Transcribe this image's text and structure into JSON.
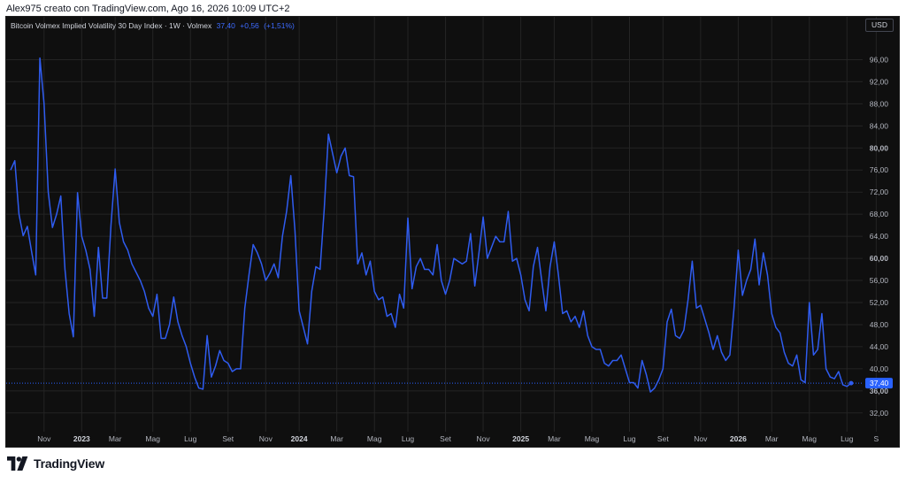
{
  "header": {
    "caption": "Alex975 creato con TradingView.com, Ago 16, 2026 10:09 UTC+2"
  },
  "legend": {
    "title": "Bitcoin Volmex Implied Volatility 30 Day Index · 1W · Volmex",
    "last": "37,40",
    "change": "+0,56",
    "change_pct": "(+1,51%)"
  },
  "currency_label": "USD",
  "brand": {
    "name": "TradingView",
    "logo_icon": "tradingview-logo-icon"
  },
  "colors": {
    "background": "#0f0f0f",
    "line": "#2f5cf0",
    "grid": "#242424",
    "axis_text": "#b2b5be",
    "price_tag": "#2962ff"
  },
  "chart_data": {
    "type": "line",
    "title": "Bitcoin Volmex Implied Volatility 30 Day Index · 1W · Volmex",
    "xlabel": "",
    "ylabel": "",
    "ylim": [
      28.6,
      100.4
    ],
    "grid": true,
    "last_value_label": "37,40",
    "y_ticks": [
      32,
      36,
      40,
      44,
      48,
      52,
      56,
      60,
      64,
      68,
      72,
      76,
      80,
      84,
      88,
      92,
      96
    ],
    "y_tick_labels": [
      "32,00",
      "36,00",
      "40,00",
      "44,00",
      "48,00",
      "52,00",
      "56,00",
      "60,00",
      "64,00",
      "68,00",
      "72,00",
      "76,00",
      "80,00",
      "84,00",
      "88,00",
      "92,00",
      "96,00"
    ],
    "y_tick_bold": [
      false,
      true,
      false,
      false,
      false,
      false,
      false,
      true,
      false,
      false,
      false,
      false,
      true,
      false,
      false,
      false,
      false
    ],
    "x_ticks": [
      {
        "label": "Nov",
        "week": 8,
        "bold": false
      },
      {
        "label": "2023",
        "week": 17,
        "bold": true
      },
      {
        "label": "Mar",
        "week": 25,
        "bold": false
      },
      {
        "label": "Mag",
        "week": 34,
        "bold": false
      },
      {
        "label": "Lug",
        "week": 43,
        "bold": false
      },
      {
        "label": "Set",
        "week": 52,
        "bold": false
      },
      {
        "label": "Nov",
        "week": 61,
        "bold": false
      },
      {
        "label": "2024",
        "week": 69,
        "bold": true
      },
      {
        "label": "Mar",
        "week": 78,
        "bold": false
      },
      {
        "label": "Mag",
        "week": 87,
        "bold": false
      },
      {
        "label": "Lug",
        "week": 95,
        "bold": false
      },
      {
        "label": "Set",
        "week": 104,
        "bold": false
      },
      {
        "label": "Nov",
        "week": 113,
        "bold": false
      },
      {
        "label": "2025",
        "week": 122,
        "bold": true
      },
      {
        "label": "Mar",
        "week": 130,
        "bold": false
      },
      {
        "label": "Mag",
        "week": 139,
        "bold": false
      },
      {
        "label": "Lug",
        "week": 148,
        "bold": false
      },
      {
        "label": "Set",
        "week": 156,
        "bold": false
      },
      {
        "label": "Nov",
        "week": 165,
        "bold": false
      },
      {
        "label": "2026",
        "week": 174,
        "bold": true
      },
      {
        "label": "Mar",
        "week": 182,
        "bold": false
      },
      {
        "label": "Mag",
        "week": 191,
        "bold": false
      },
      {
        "label": "Lug",
        "week": 200,
        "bold": false
      },
      {
        "label": "S",
        "week": 207,
        "bold": false
      }
    ],
    "series": [
      {
        "x_unit": "week",
        "values": [
          76,
          77.7,
          68,
          64.1,
          65.8,
          61.3,
          57,
          96.3,
          88,
          72,
          65.6,
          68,
          71.3,
          58,
          50,
          45.8,
          71.9,
          64,
          61.4,
          58,
          49.5,
          62,
          52.8,
          52.8,
          66,
          76.2,
          66.5,
          63,
          61.5,
          59,
          57.5,
          56,
          54,
          51,
          49.5,
          53.5,
          45.5,
          45.5,
          48,
          53,
          48.5,
          46,
          44,
          41,
          38.5,
          36.5,
          36.3,
          46,
          38.5,
          40.5,
          43.3,
          41.5,
          41,
          39.5,
          40,
          40,
          51,
          57,
          62.5,
          61,
          59,
          56,
          57.3,
          59,
          56.5,
          64,
          68.5,
          75,
          65,
          50.5,
          47.5,
          44.5,
          54,
          58.5,
          58,
          69,
          82.5,
          79,
          75.5,
          78.5,
          80,
          75,
          74.8,
          59,
          61,
          57,
          59.5,
          54,
          52.5,
          53,
          49.5,
          50,
          47.5,
          53.5,
          51,
          67.3,
          54.5,
          58.5,
          60,
          58,
          58,
          57,
          62.5,
          56,
          53.5,
          56,
          60,
          59.5,
          59,
          59.5,
          64.5,
          55,
          61,
          67.5,
          60,
          62,
          64,
          63,
          63,
          68.5,
          59.5,
          60,
          57,
          52.5,
          50.5,
          58.5,
          62,
          56,
          50.5,
          58.5,
          63,
          57,
          50,
          50.5,
          48.5,
          49.5,
          47.5,
          50.5,
          46,
          44,
          43.5,
          43.5,
          41,
          40.5,
          41.5,
          41.5,
          42.5,
          40,
          37.5,
          37.5,
          36.5,
          41.5,
          39,
          35.8,
          36.5,
          38,
          40,
          48.5,
          50.8,
          46,
          45.5,
          47,
          52.5,
          59.5,
          51,
          51.5,
          49,
          46.5,
          43.5,
          46,
          43,
          41.5,
          42.5,
          51,
          61.5,
          53.3,
          56,
          58,
          63.5,
          55.2,
          61,
          57,
          50,
          47.5,
          46.5,
          43,
          41,
          40.5,
          42.5,
          38,
          37.5,
          52,
          42.5,
          43.5,
          50,
          40,
          38.5,
          38.2,
          39.5,
          37.1,
          36.8,
          37.4
        ]
      }
    ]
  }
}
